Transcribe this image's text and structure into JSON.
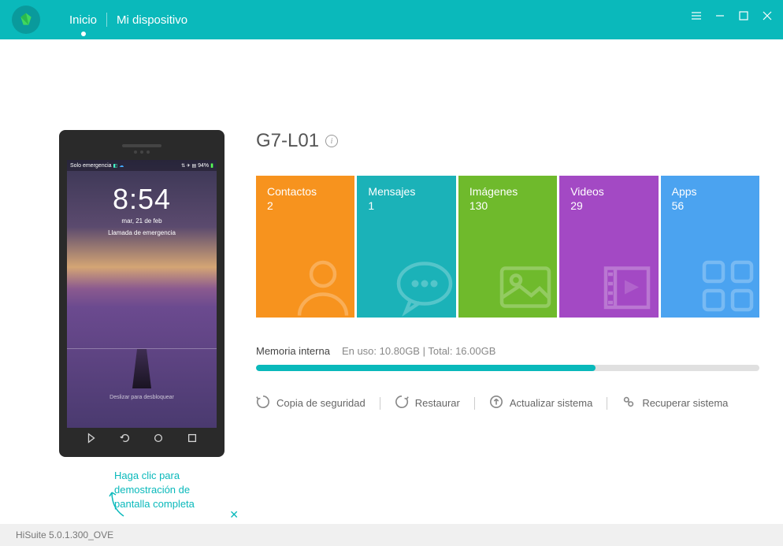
{
  "nav": {
    "home": "Inicio",
    "device": "Mi dispositivo"
  },
  "phone": {
    "status_left": "Solo emergencia",
    "status_battery": "94%",
    "time": "8:54",
    "date": "mar, 21 de feb",
    "emergency": "Llamada de emergencia",
    "unlock": "Deslizar para desbloquear"
  },
  "hint": {
    "text": "Haga clic para demostración de pantalla completa"
  },
  "device": {
    "name": "G7-L01"
  },
  "tiles": [
    {
      "label": "Contactos",
      "value": "2",
      "color": "#f7931e"
    },
    {
      "label": "Mensajes",
      "value": "1",
      "color": "#1bb2b8"
    },
    {
      "label": "Imágenes",
      "value": "130",
      "color": "#6fba2c"
    },
    {
      "label": "Videos",
      "value": "29",
      "color": "#a349c4"
    },
    {
      "label": "Apps",
      "value": "56",
      "color": "#4ba3f0"
    }
  ],
  "memory": {
    "label": "Memoria interna",
    "used_label": "En uso:",
    "used": "10.80GB",
    "total_label": "Total:",
    "total": "16.00GB",
    "percent": 67.5
  },
  "actions": {
    "backup": "Copia de seguridad",
    "restore": "Restaurar",
    "update": "Actualizar sistema",
    "recover": "Recuperar sistema"
  },
  "footer": {
    "version": "HiSuite 5.0.1.300_OVE"
  }
}
